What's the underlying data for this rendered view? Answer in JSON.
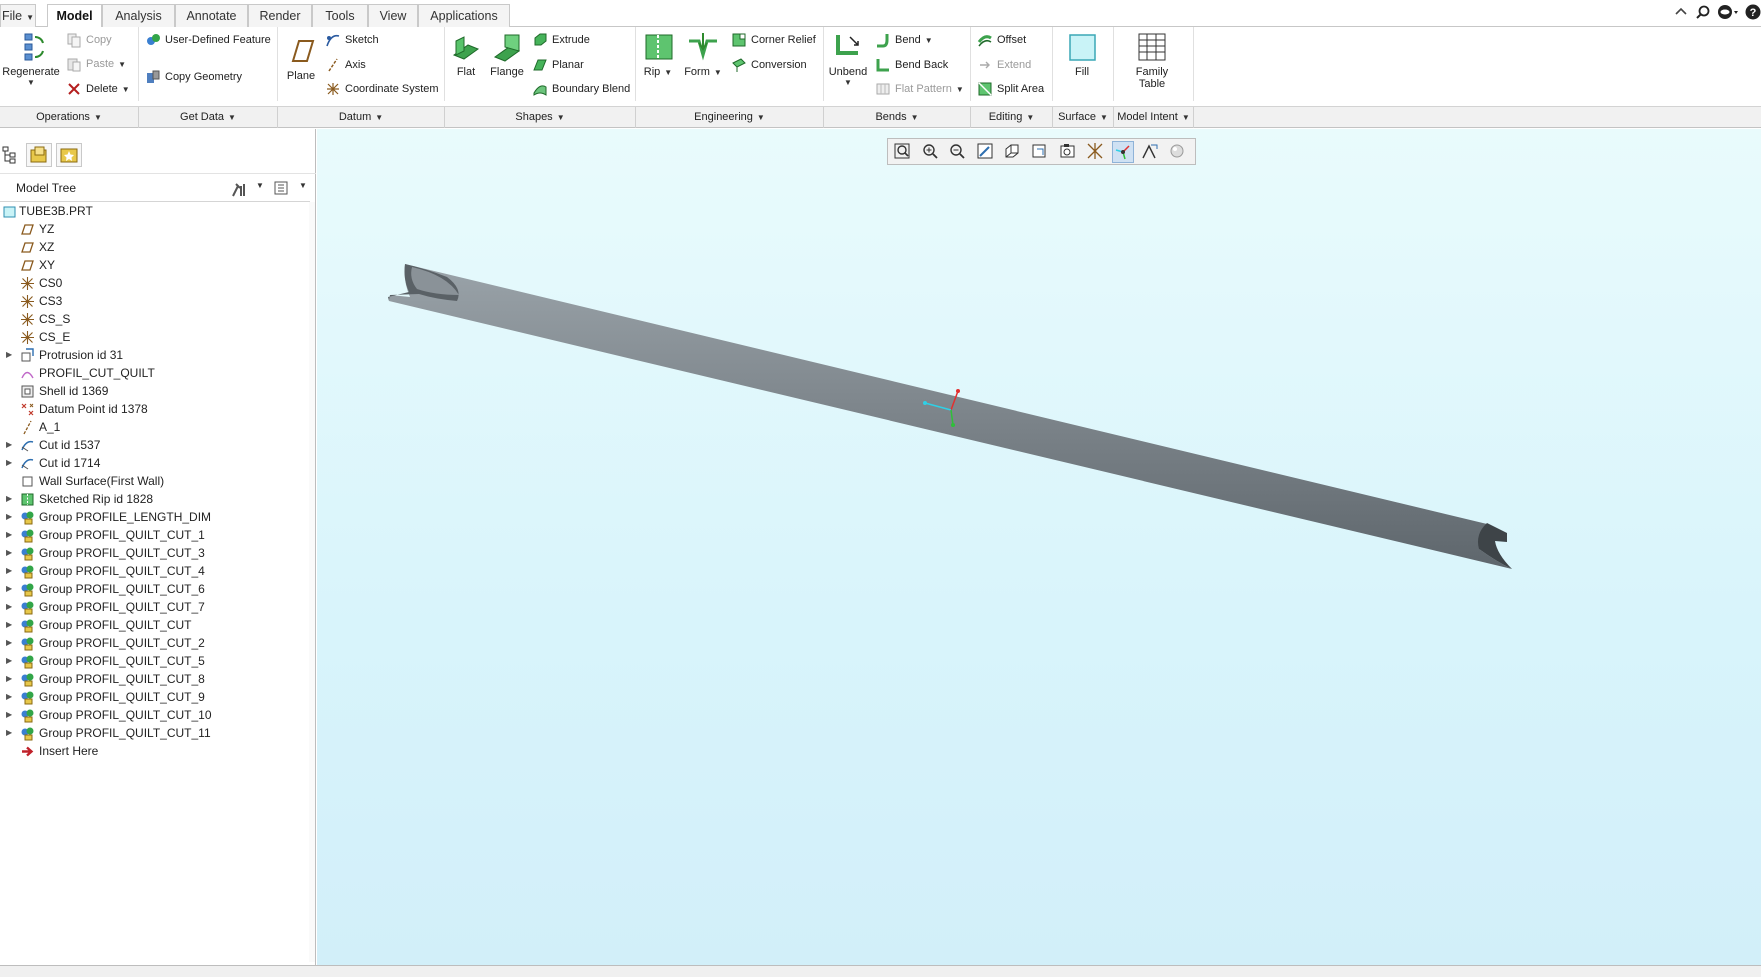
{
  "tabs": [
    {
      "label": "File",
      "dropdown": true
    },
    {
      "label": "Model",
      "active": true
    },
    {
      "label": "Analysis"
    },
    {
      "label": "Annotate"
    },
    {
      "label": "Render"
    },
    {
      "label": "Tools"
    },
    {
      "label": "View"
    },
    {
      "label": "Applications"
    }
  ],
  "ribbon": {
    "operations": {
      "regenerate": "Regenerate",
      "copy": "Copy",
      "paste": "Paste",
      "delete": "Delete"
    },
    "get_data": {
      "user_defined_feature": "User-Defined Feature",
      "copy_geometry": "Copy Geometry"
    },
    "datum": {
      "plane": "Plane",
      "sketch": "Sketch",
      "axis": "Axis",
      "coordinate_system": "Coordinate System"
    },
    "shapes": {
      "flat": "Flat",
      "flange": "Flange",
      "extrude": "Extrude",
      "planar": "Planar",
      "boundary_blend": "Boundary Blend"
    },
    "engineering": {
      "rip": "Rip",
      "form": "Form",
      "corner_relief": "Corner Relief",
      "conversion": "Conversion"
    },
    "bends": {
      "unbend": "Unbend",
      "bend": "Bend",
      "bend_back": "Bend Back",
      "flat_pattern": "Flat Pattern"
    },
    "editing": {
      "offset": "Offset",
      "extend": "Extend",
      "split_area": "Split Area"
    },
    "surface": {
      "fill": "Fill"
    },
    "model_intent": {
      "family_table_line1": "Family",
      "family_table_line2": "Table"
    }
  },
  "groups": [
    "Operations",
    "Get Data",
    "Datum",
    "Shapes",
    "Engineering",
    "Bends",
    "Editing",
    "Surface",
    "Model Intent"
  ],
  "model_tree": {
    "title": "Model Tree",
    "items": [
      {
        "label": "TUBE3B.PRT",
        "icon": "part-icon",
        "root": true
      },
      {
        "label": "YZ",
        "icon": "datum-plane-icon"
      },
      {
        "label": "XZ",
        "icon": "datum-plane-icon"
      },
      {
        "label": "XY",
        "icon": "datum-plane-icon"
      },
      {
        "label": "CS0",
        "icon": "coordinate-system-icon"
      },
      {
        "label": "CS3",
        "icon": "coordinate-system-icon"
      },
      {
        "label": "CS_S",
        "icon": "coordinate-system-icon"
      },
      {
        "label": "CS_E",
        "icon": "coordinate-system-icon"
      },
      {
        "label": "Protrusion id 31",
        "icon": "protrusion-icon",
        "expandable": true
      },
      {
        "label": "PROFIL_CUT_QUILT",
        "icon": "quilt-icon"
      },
      {
        "label": "Shell id 1369",
        "icon": "shell-icon"
      },
      {
        "label": "Datum Point id 1378",
        "icon": "datum-point-icon"
      },
      {
        "label": "A_1",
        "icon": "axis-icon"
      },
      {
        "label": "Cut id 1537",
        "icon": "cut-icon",
        "expandable": true
      },
      {
        "label": "Cut id 1714",
        "icon": "cut-icon",
        "expandable": true
      },
      {
        "label": "Wall Surface(First Wall)",
        "icon": "wall-surface-icon"
      },
      {
        "label": "Sketched Rip id 1828",
        "icon": "rip-icon",
        "expandable": true
      },
      {
        "label": "Group PROFILE_LENGTH_DIM",
        "icon": "group-icon",
        "expandable": true
      },
      {
        "label": "Group PROFIL_QUILT_CUT_1",
        "icon": "group-icon",
        "expandable": true
      },
      {
        "label": "Group PROFIL_QUILT_CUT_3",
        "icon": "group-icon",
        "expandable": true
      },
      {
        "label": "Group PROFIL_QUILT_CUT_4",
        "icon": "group-icon",
        "expandable": true
      },
      {
        "label": "Group PROFIL_QUILT_CUT_6",
        "icon": "group-icon",
        "expandable": true
      },
      {
        "label": "Group PROFIL_QUILT_CUT_7",
        "icon": "group-icon",
        "expandable": true
      },
      {
        "label": "Group PROFIL_QUILT_CUT",
        "icon": "group-icon",
        "expandable": true
      },
      {
        "label": "Group PROFIL_QUILT_CUT_2",
        "icon": "group-icon",
        "expandable": true
      },
      {
        "label": "Group PROFIL_QUILT_CUT_5",
        "icon": "group-icon",
        "expandable": true
      },
      {
        "label": "Group PROFIL_QUILT_CUT_8",
        "icon": "group-icon",
        "expandable": true
      },
      {
        "label": "Group PROFIL_QUILT_CUT_9",
        "icon": "group-icon",
        "expandable": true
      },
      {
        "label": "Group PROFIL_QUILT_CUT_10",
        "icon": "group-icon",
        "expandable": true
      },
      {
        "label": "Group PROFIL_QUILT_CUT_11",
        "icon": "group-icon",
        "expandable": true
      },
      {
        "label": "Insert Here",
        "icon": "insert-here-icon"
      }
    ]
  },
  "graphics_toolbar": [
    {
      "icon": "refit-icon"
    },
    {
      "icon": "zoom-in-icon"
    },
    {
      "icon": "zoom-out-icon"
    },
    {
      "icon": "repaint-icon"
    },
    {
      "icon": "display-style-icon"
    },
    {
      "icon": "saved-orientations-icon"
    },
    {
      "icon": "view-manager-icon"
    },
    {
      "icon": "datum-display-icon"
    },
    {
      "icon": "spin-center-icon",
      "active": true
    },
    {
      "icon": "annotation-display-icon"
    },
    {
      "icon": "appearance-icon"
    }
  ],
  "colors": {
    "viewport_top": "#e9fbfc",
    "viewport_bottom": "#d2eff9",
    "part_shade": "#7e868c"
  }
}
